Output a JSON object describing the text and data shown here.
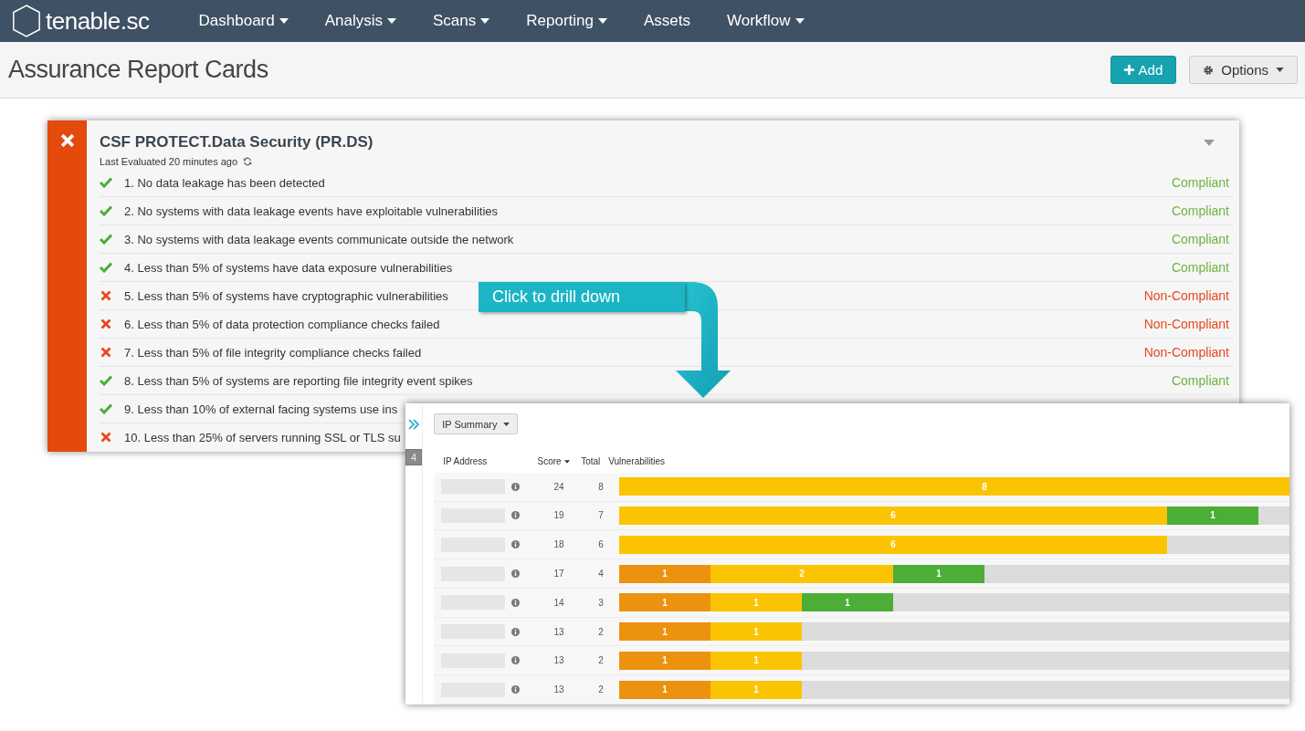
{
  "navbar": {
    "logo": "tenable.sc",
    "items": [
      {
        "label": "Dashboard",
        "has_menu": true
      },
      {
        "label": "Analysis",
        "has_menu": true
      },
      {
        "label": "Scans",
        "has_menu": true
      },
      {
        "label": "Reporting",
        "has_menu": true
      },
      {
        "label": "Assets",
        "has_menu": false
      },
      {
        "label": "Workflow",
        "has_menu": true
      }
    ]
  },
  "page": {
    "title": "Assurance Report Cards",
    "buttons": [
      {
        "kind": "add",
        "label": "Add"
      },
      {
        "kind": "options",
        "label": "Options"
      }
    ]
  },
  "card": {
    "compliant": false,
    "title": "CSF PROTECT.Data Security (PR.DS)",
    "last_evaluated": "Last Evaluated 20 minutes ago",
    "rows": [
      {
        "text": "1. No data leakage has been detected",
        "compliant": true,
        "status": "Compliant"
      },
      {
        "text": "2. No systems with data leakage events have exploitable vulnerabilities",
        "compliant": true,
        "status": "Compliant"
      },
      {
        "text": "3. No systems with data leakage events communicate outside the network",
        "compliant": true,
        "status": "Compliant"
      },
      {
        "text": "4. Less than 5% of systems have data exposure vulnerabilities",
        "compliant": true,
        "status": "Compliant"
      },
      {
        "text": "5. Less than 5% of systems have cryptographic vulnerabilities",
        "compliant": false,
        "status": "Non-Compliant"
      },
      {
        "text": "6. Less than 5% of data protection compliance checks failed",
        "compliant": false,
        "status": "Non-Compliant"
      },
      {
        "text": "7. Less than 5% of file integrity compliance checks failed",
        "compliant": false,
        "status": "Non-Compliant"
      },
      {
        "text": "8. Less than 5% of systems are reporting file integrity event spikes",
        "compliant": true,
        "status": "Compliant"
      },
      {
        "text": "9. Less than 10% of external facing systems use ins",
        "compliant": true
      },
      {
        "text": "10. Less than 25% of servers running SSL or TLS su",
        "compliant": false
      }
    ]
  },
  "callout": {
    "text": "Click to drill down"
  },
  "drilldown": {
    "count": "4",
    "tool": "IP Summary",
    "columns": [
      "IP Address",
      "Score",
      "Total",
      "Vulnerabilities"
    ],
    "rows": [
      {
        "score": "24",
        "total": "8",
        "segments": [
          {
            "value": "8",
            "color": "#fbc403"
          }
        ]
      },
      {
        "score": "19",
        "total": "7",
        "segments": [
          {
            "value": "6",
            "color": "#fbc403"
          },
          {
            "value": "1",
            "color": "#4cae37"
          }
        ]
      },
      {
        "score": "18",
        "total": "6",
        "segments": [
          {
            "value": "6",
            "color": "#fbc403"
          }
        ]
      },
      {
        "score": "17",
        "total": "4",
        "segments": [
          {
            "value": "1",
            "color": "#ec920f"
          },
          {
            "value": "2",
            "color": "#fbc403"
          },
          {
            "value": "1",
            "color": "#4cae37"
          }
        ]
      },
      {
        "score": "14",
        "total": "3",
        "segments": [
          {
            "value": "1",
            "color": "#ec920f"
          },
          {
            "value": "1",
            "color": "#fbc403"
          },
          {
            "value": "1",
            "color": "#4cae37"
          }
        ]
      },
      {
        "score": "13",
        "total": "2",
        "segments": [
          {
            "value": "1",
            "color": "#ec920f"
          },
          {
            "value": "1",
            "color": "#fbc403"
          }
        ]
      },
      {
        "score": "13",
        "total": "2",
        "segments": [
          {
            "value": "1",
            "color": "#ec920f"
          },
          {
            "value": "1",
            "color": "#fbc403"
          }
        ]
      },
      {
        "score": "13",
        "total": "2",
        "segments": [
          {
            "value": "1",
            "color": "#ec920f"
          },
          {
            "value": "1",
            "color": "#fbc403"
          }
        ]
      }
    ]
  }
}
